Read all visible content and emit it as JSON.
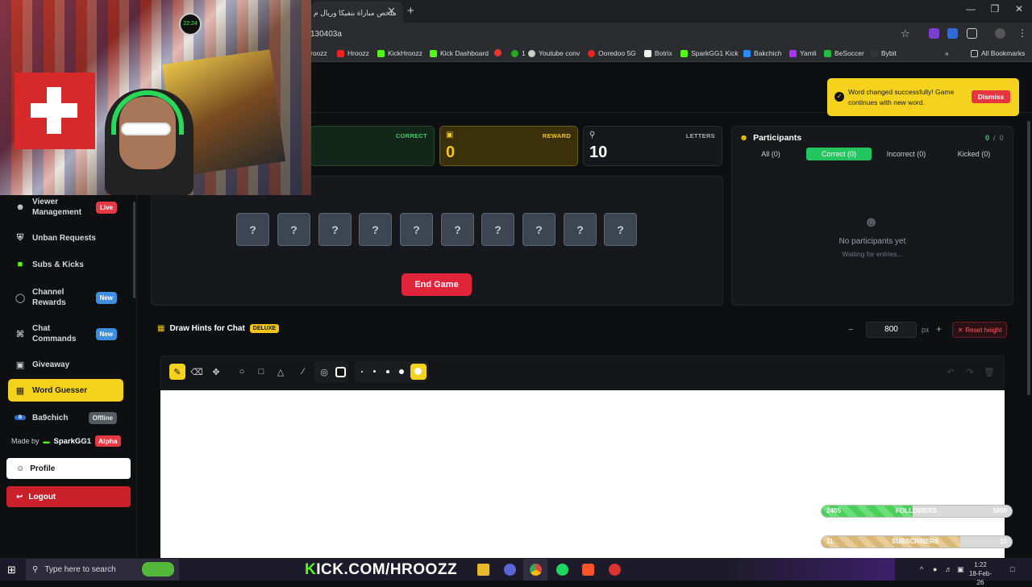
{
  "browser": {
    "tab_title": "ملخص مباراة بنفيكا وريال م",
    "url": "130403a",
    "bookmarks": [
      "roozz",
      "Hroozz",
      "KickHroozz",
      "Kick Dashboard",
      "",
      "1",
      "Youtube conv",
      "Ooredoo 5G",
      "Botrix",
      "SparkGG1 Kick",
      "Bakchich",
      "Yamli",
      "BeSoccer",
      "Bybit"
    ],
    "all_bookmarks": "All Bookmarks"
  },
  "sidebar": {
    "items": [
      {
        "label": "Viewer Management",
        "icon": "users-icon",
        "badge": "Live"
      },
      {
        "label": "Unban Requests",
        "icon": "shield-icon",
        "badge": ""
      },
      {
        "label": "Subs & Kicks",
        "icon": "kick-icon",
        "badge": ""
      },
      {
        "label": "Channel Rewards",
        "icon": "award-icon",
        "badge": "New"
      },
      {
        "label": "Chat Commands",
        "icon": "command-icon",
        "badge": "New"
      },
      {
        "label": "Giveaway",
        "icon": "gift-icon",
        "badge": ""
      },
      {
        "label": "Word Guesser",
        "icon": "gamepad-icon",
        "badge": ""
      },
      {
        "label": "Ba9chich",
        "icon": "ba9chich-icon",
        "badge": "Offline"
      }
    ],
    "made_by": "Made by",
    "author": "SparkGG1",
    "alpha": "Alpha",
    "profile": "Profile",
    "logout": "Logout"
  },
  "stats": {
    "correct_label": "CORRECT",
    "reward_label": "REWARD",
    "reward_value": "0",
    "letters_label": "LETTERS",
    "letters_value": "10"
  },
  "game": {
    "slots": [
      "?",
      "?",
      "?",
      "?",
      "?",
      "?",
      "?",
      "?",
      "?",
      "?"
    ],
    "end_game": "End Game"
  },
  "participants": {
    "title": "Participants",
    "count_correct": "0",
    "count_sep": "/",
    "count_total": "0",
    "tabs": [
      "All (0)",
      "Correct (0)",
      "Incorrect (0)",
      "Kicked (0)"
    ],
    "active_tab": "Correct (0)",
    "empty_title": "No participants yet",
    "empty_sub": "Waiting for entries..."
  },
  "draw": {
    "title": "Draw Hints for Chat",
    "badge": "DELUXE",
    "height_value": "800",
    "height_unit": "px",
    "reset_height": "Reset height"
  },
  "toast": {
    "message": "Word changed successfully! Game continues with new word.",
    "dismiss": "Dismiss"
  },
  "overlay": {
    "followers": {
      "current": "2405",
      "label": "FOLLOWERS",
      "goal": "5000",
      "fraction": 0.48,
      "color": "#4ccf5a"
    },
    "subscribers": {
      "current": "11",
      "label": "SUBSCRIBERS",
      "goal": "15",
      "fraction": 0.73,
      "color": "#d9b777"
    },
    "webcam_clock": "22:24"
  },
  "taskbar": {
    "search": "Type here to search",
    "kick_prefix": "K",
    "kick_text": "ICK.COM/HROOZZ",
    "time": "1:22",
    "date": "18-Feb-26"
  },
  "colors": {
    "accent": "#f5d31d",
    "danger": "#e0243a",
    "success": "#22c55e"
  }
}
